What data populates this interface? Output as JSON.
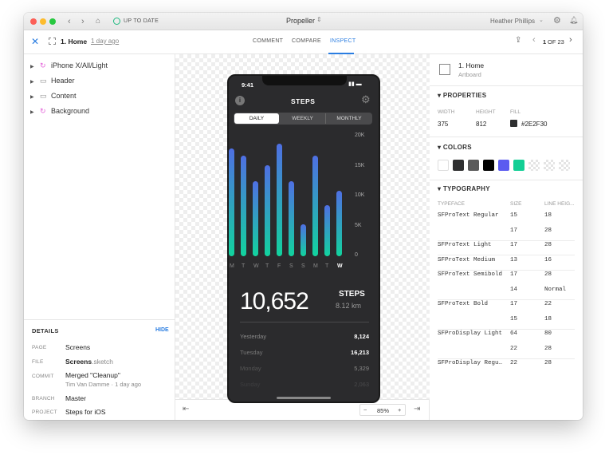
{
  "titlebar": {
    "sync_status": "UP TO DATE",
    "app_name": "Propeller",
    "user_name": "Heather Phillips"
  },
  "toolbar": {
    "artboard_name": "1. Home",
    "timestamp": "1 day ago",
    "tabs": [
      "COMMENT",
      "COMPARE",
      "INSPECT"
    ],
    "active_tab": "INSPECT",
    "page_current": "1",
    "page_of": "OF 23"
  },
  "layers": [
    {
      "label": "iPhone X/All/Light",
      "icon": "symbol-icon"
    },
    {
      "label": "Header",
      "icon": "folder-icon"
    },
    {
      "label": "Content",
      "icon": "folder-icon"
    },
    {
      "label": "Background",
      "icon": "symbol-icon"
    }
  ],
  "details": {
    "title": "DETAILS",
    "hide_label": "HIDE",
    "page_label": "PAGE",
    "page_value": "Screens",
    "file_label": "FILE",
    "file_name": "Screens",
    "file_ext": ".sketch",
    "commit_label": "COMMIT",
    "commit_message": "Merged \"Cleanup\"",
    "commit_meta": "Tim Van Damme · 1 day ago",
    "branch_label": "BRANCH",
    "branch_value": "Master",
    "project_label": "PROJECT",
    "project_value": "Steps for iOS"
  },
  "canvas": {
    "zoom": "85%",
    "zoom_minus": "−",
    "zoom_plus": "+"
  },
  "phone": {
    "time": "9:41",
    "title": "STEPS",
    "segments": [
      "DAILY",
      "WEEKLY",
      "MONTHLY"
    ],
    "active_segment": "DAILY",
    "y_ticks": [
      "20K",
      "15K",
      "10K",
      "5K",
      "0"
    ],
    "days": [
      "M",
      "T",
      "W",
      "T",
      "F",
      "S",
      "S",
      "M",
      "T",
      "W"
    ],
    "big_number": "10,652",
    "big_label": "STEPS",
    "distance": "8.12 km",
    "history": [
      {
        "day": "Yesterday",
        "value": "8,124"
      },
      {
        "day": "Tuesday",
        "value": "16,213"
      },
      {
        "day": "Monday",
        "value": "5,329"
      },
      {
        "day": "Sunday",
        "value": "2,063"
      }
    ]
  },
  "chart_data": {
    "type": "bar",
    "categories": [
      "M",
      "T",
      "W",
      "T",
      "F",
      "S",
      "S",
      "M",
      "T",
      "W"
    ],
    "values": [
      18000,
      16800,
      12500,
      15200,
      18800,
      12500,
      5300,
      16800,
      8500,
      11000
    ],
    "title": "STEPS",
    "xlabel": "",
    "ylabel": "",
    "ylim": [
      0,
      20000
    ]
  },
  "inspector": {
    "artboard_name": "1. Home",
    "artboard_type": "Artboard",
    "properties_title": "PROPERTIES",
    "width_label": "WIDTH",
    "width_value": "375",
    "height_label": "HEIGHT",
    "height_value": "812",
    "fill_label": "FILL",
    "fill_value": "#2E2F30",
    "colors_title": "COLORS",
    "colors": [
      "#ffffff",
      "#2e2f30",
      "#5a5a5a",
      "#000000",
      "#5b5bf0",
      "#12cf95"
    ],
    "typography_title": "TYPOGRAPHY",
    "typeface_header": "TYPEFACE",
    "size_header": "SIZE",
    "lineheight_header": "LINE HEIG...",
    "typography": [
      {
        "face": "SFProText Regular",
        "size": "15",
        "lh": "18"
      },
      {
        "face": "",
        "size": "17",
        "lh": "28"
      },
      {
        "face": "SFProText Light",
        "size": "17",
        "lh": "28"
      },
      {
        "face": "SFProText Medium",
        "size": "13",
        "lh": "16"
      },
      {
        "face": "SFProText Semibold",
        "size": "17",
        "lh": "28"
      },
      {
        "face": "",
        "size": "14",
        "lh": "Normal"
      },
      {
        "face": "SFProText Bold",
        "size": "17",
        "lh": "22"
      },
      {
        "face": "",
        "size": "15",
        "lh": "18"
      },
      {
        "face": "SFProDisplay Light",
        "size": "64",
        "lh": "80"
      },
      {
        "face": "",
        "size": "22",
        "lh": "28"
      },
      {
        "face": "SFProDisplay Regu…",
        "size": "22",
        "lh": "28"
      }
    ]
  }
}
